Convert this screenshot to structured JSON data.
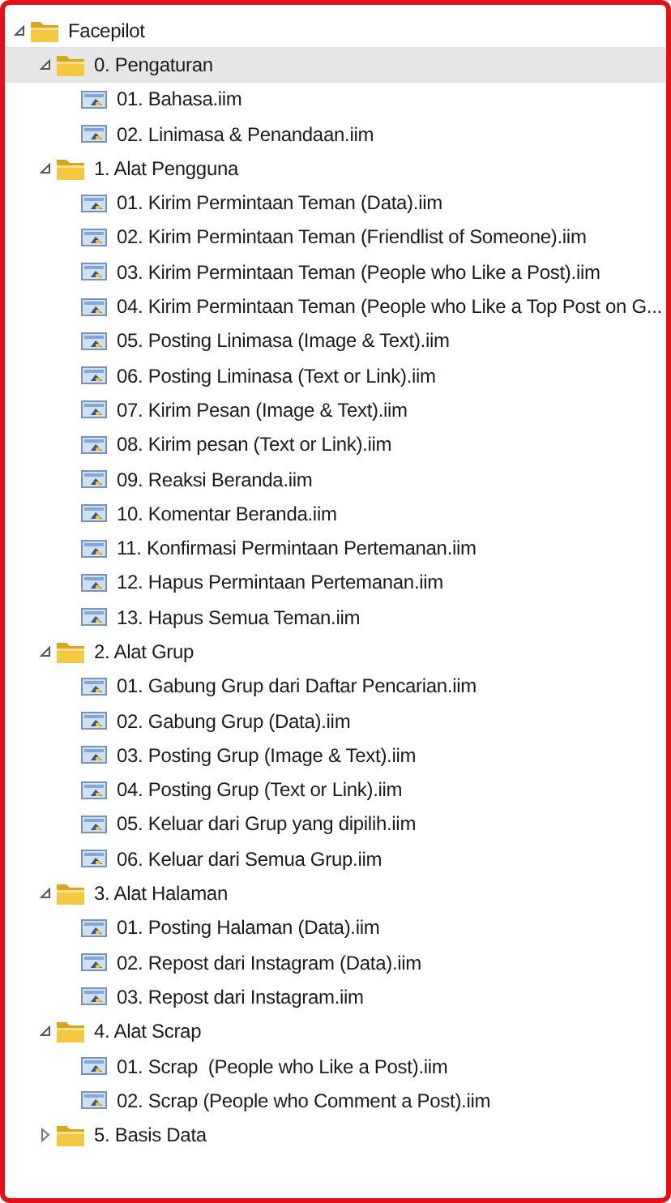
{
  "tree": [
    {
      "kind": "folder",
      "label": "Facepilot",
      "expanded": true,
      "selected": false,
      "children": [
        {
          "kind": "folder",
          "label": "0. Pengaturan",
          "expanded": true,
          "selected": true,
          "children": [
            {
              "kind": "file",
              "label": "01. Bahasa.iim",
              "selected": false
            },
            {
              "kind": "file",
              "label": "02. Linimasa & Penandaan.iim",
              "selected": false
            }
          ]
        },
        {
          "kind": "folder",
          "label": "1. Alat Pengguna",
          "expanded": true,
          "selected": false,
          "children": [
            {
              "kind": "file",
              "label": "01. Kirim Permintaan Teman (Data).iim",
              "selected": false
            },
            {
              "kind": "file",
              "label": "02. Kirim Permintaan Teman (Friendlist of Someone).iim",
              "selected": false
            },
            {
              "kind": "file",
              "label": "03. Kirim Permintaan Teman (People who Like a Post).iim",
              "selected": false
            },
            {
              "kind": "file",
              "label": "04. Kirim Permintaan Teman (People who Like a Top Post on G...",
              "selected": false
            },
            {
              "kind": "file",
              "label": "05. Posting Linimasa (Image & Text).iim",
              "selected": false
            },
            {
              "kind": "file",
              "label": "06. Posting Liminasa (Text or Link).iim",
              "selected": false
            },
            {
              "kind": "file",
              "label": "07. Kirim Pesan (Image & Text).iim",
              "selected": false
            },
            {
              "kind": "file",
              "label": "08. Kirim pesan (Text or Link).iim",
              "selected": false
            },
            {
              "kind": "file",
              "label": "09. Reaksi Beranda.iim",
              "selected": false
            },
            {
              "kind": "file",
              "label": "10. Komentar Beranda.iim",
              "selected": false
            },
            {
              "kind": "file",
              "label": "11. Konfirmasi Permintaan Pertemanan.iim",
              "selected": false
            },
            {
              "kind": "file",
              "label": "12. Hapus Permintaan Pertemanan.iim",
              "selected": false
            },
            {
              "kind": "file",
              "label": "13. Hapus Semua Teman.iim",
              "selected": false
            }
          ]
        },
        {
          "kind": "folder",
          "label": "2. Alat Grup",
          "expanded": true,
          "selected": false,
          "children": [
            {
              "kind": "file",
              "label": "01. Gabung Grup dari Daftar Pencarian.iim",
              "selected": false
            },
            {
              "kind": "file",
              "label": "02. Gabung Grup (Data).iim",
              "selected": false
            },
            {
              "kind": "file",
              "label": "03. Posting Grup (Image & Text).iim",
              "selected": false
            },
            {
              "kind": "file",
              "label": "04. Posting Grup (Text or Link).iim",
              "selected": false
            },
            {
              "kind": "file",
              "label": "05. Keluar dari Grup yang dipilih.iim",
              "selected": false
            },
            {
              "kind": "file",
              "label": "06. Keluar dari Semua Grup.iim",
              "selected": false
            }
          ]
        },
        {
          "kind": "folder",
          "label": "3. Alat Halaman",
          "expanded": true,
          "selected": false,
          "children": [
            {
              "kind": "file",
              "label": "01. Posting Halaman (Data).iim",
              "selected": false
            },
            {
              "kind": "file",
              "label": "02. Repost dari Instagram (Data).iim",
              "selected": false
            },
            {
              "kind": "file",
              "label": "03. Repost dari Instagram.iim",
              "selected": false
            }
          ]
        },
        {
          "kind": "folder",
          "label": "4. Alat Scrap",
          "expanded": true,
          "selected": false,
          "children": [
            {
              "kind": "file",
              "label": "01. Scrap  (People who Like a Post).iim",
              "selected": false
            },
            {
              "kind": "file",
              "label": "02. Scrap (People who Comment a Post).iim",
              "selected": false
            }
          ]
        },
        {
          "kind": "folder",
          "label": "5. Basis Data",
          "expanded": false,
          "selected": false
        }
      ]
    }
  ]
}
